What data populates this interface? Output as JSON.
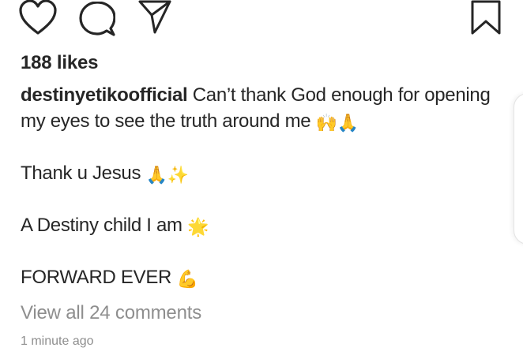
{
  "actions": {
    "like_icon": "heart-icon",
    "comment_icon": "comment-bubble-icon",
    "share_icon": "paper-plane-icon",
    "save_icon": "bookmark-icon"
  },
  "post": {
    "likes": "188 likes",
    "username": "destinyetikoofficial",
    "caption": [
      {
        "text": " Can’t thank God enough for opening my eyes to see the truth around me ",
        "emoji": "🙌🙏"
      },
      {
        "text": "Thank u Jesus ",
        "emoji": "🙏✨"
      },
      {
        "text": "A Destiny child I am ",
        "emoji": "🌟"
      },
      {
        "text": "FORWARD EVER ",
        "emoji": "💪"
      }
    ],
    "view_comments": "View all 24 comments",
    "timestamp": "1 minute ago"
  }
}
